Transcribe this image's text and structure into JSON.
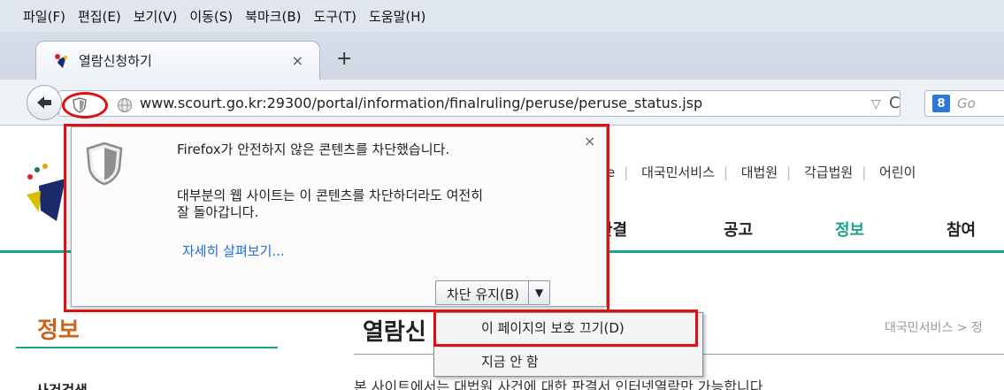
{
  "menubar": {
    "items": [
      "파일(F)",
      "편집(E)",
      "보기(V)",
      "이동(S)",
      "북마크(B)",
      "도구(T)",
      "도움말(H)"
    ]
  },
  "tab": {
    "title": "열람신청하기",
    "close": "×",
    "new_tab": "+"
  },
  "navbar": {
    "url": "www.scourt.go.kr:29300/portal/information/finalruling/peruse/peruse_status.jsp",
    "dropdown_arrow": "▽",
    "refresh": "C",
    "search_engine": "8",
    "search_text": "Go"
  },
  "page": {
    "topnav": [
      "e",
      "대국민서비스",
      "대법원",
      "각급법원",
      "어린이"
    ],
    "mainnav": [
      "관결",
      "공고",
      "정보",
      "참여"
    ],
    "side_title": "정보",
    "side_item": "사건검색",
    "page_title": "열람신",
    "breadcrumb": "대국민서비스 > 정",
    "notice": "본 사이트에서는 대법원 사건에 대한 판결서 인터넷열람만 가능합니다."
  },
  "popup": {
    "heading": "Firefox가 안전하지 않은 콘텐츠를 차단했습니다.",
    "body": "대부분의 웹 사이트는 이 콘텐츠를 차단하더라도 여전히 잘 돌아갑니다.",
    "link": "자세히 살펴보기...",
    "close": "×",
    "keep_blocking": "차단 유지(B)",
    "dropdown_arrow": "▼"
  },
  "menu": {
    "disable_protection": "이 페이지의 보호 끄기(D)",
    "not_now": "지금 안 함"
  },
  "colors": {
    "annotation_red": "#e01010",
    "accent_green": "#1ea38a",
    "side_title_orange": "#c8651b",
    "link_blue": "#1a6fd6"
  }
}
